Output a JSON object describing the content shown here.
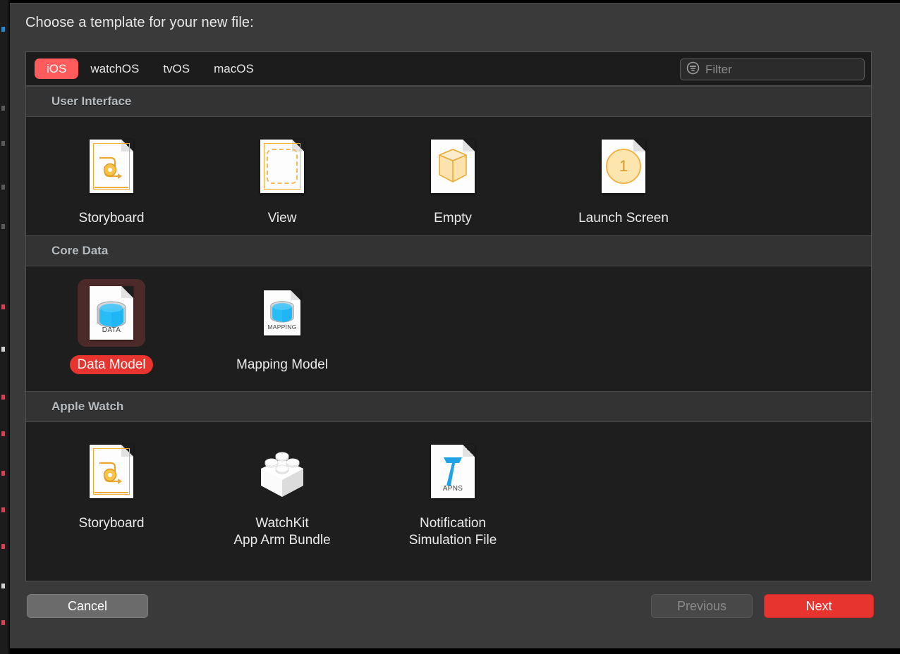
{
  "dialog": {
    "prompt": "Choose a template for your new file:"
  },
  "platform_tabs": [
    {
      "label": "iOS",
      "selected": true
    },
    {
      "label": "watchOS",
      "selected": false
    },
    {
      "label": "tvOS",
      "selected": false
    },
    {
      "label": "macOS",
      "selected": false
    }
  ],
  "filter": {
    "placeholder": "Filter",
    "value": "",
    "icon": "filter-circle-icon"
  },
  "sections": [
    {
      "title": "User Interface",
      "items": [
        {
          "label": "Storyboard",
          "icon": "storyboard-document-icon",
          "selected": false
        },
        {
          "label": "View",
          "icon": "view-document-icon",
          "selected": false
        },
        {
          "label": "Empty",
          "icon": "empty-cube-document-icon",
          "selected": false
        },
        {
          "label": "Launch Screen",
          "icon": "launch-screen-document-icon",
          "selected": false
        }
      ]
    },
    {
      "title": "Core Data",
      "items": [
        {
          "label": "Data Model",
          "icon": "data-model-document-icon",
          "caption": "DATA",
          "selected": true
        },
        {
          "label": "Mapping Model",
          "icon": "mapping-model-document-icon",
          "caption": "MAPPING",
          "selected": false
        }
      ]
    },
    {
      "title": "Apple Watch",
      "items": [
        {
          "label": "Storyboard",
          "icon": "storyboard-document-icon",
          "selected": false
        },
        {
          "label": "WatchKit",
          "label_line2": "App Arm Bundle",
          "icon": "watchkit-brick-icon",
          "selected": false
        },
        {
          "label": "Notification",
          "label_line2": "Simulation File",
          "icon": "notification-apns-document-icon",
          "caption": "APNS",
          "selected": false
        }
      ]
    }
  ],
  "buttons": {
    "cancel": "Cancel",
    "previous": "Previous",
    "next": "Next"
  },
  "colors": {
    "accent_red": "#e8342e",
    "tab_selected_red": "#ff5a5c",
    "selection_highlight": "#4d2a2a",
    "panel_background": "#1e1e1e",
    "dialog_background": "#3a3a3a"
  }
}
